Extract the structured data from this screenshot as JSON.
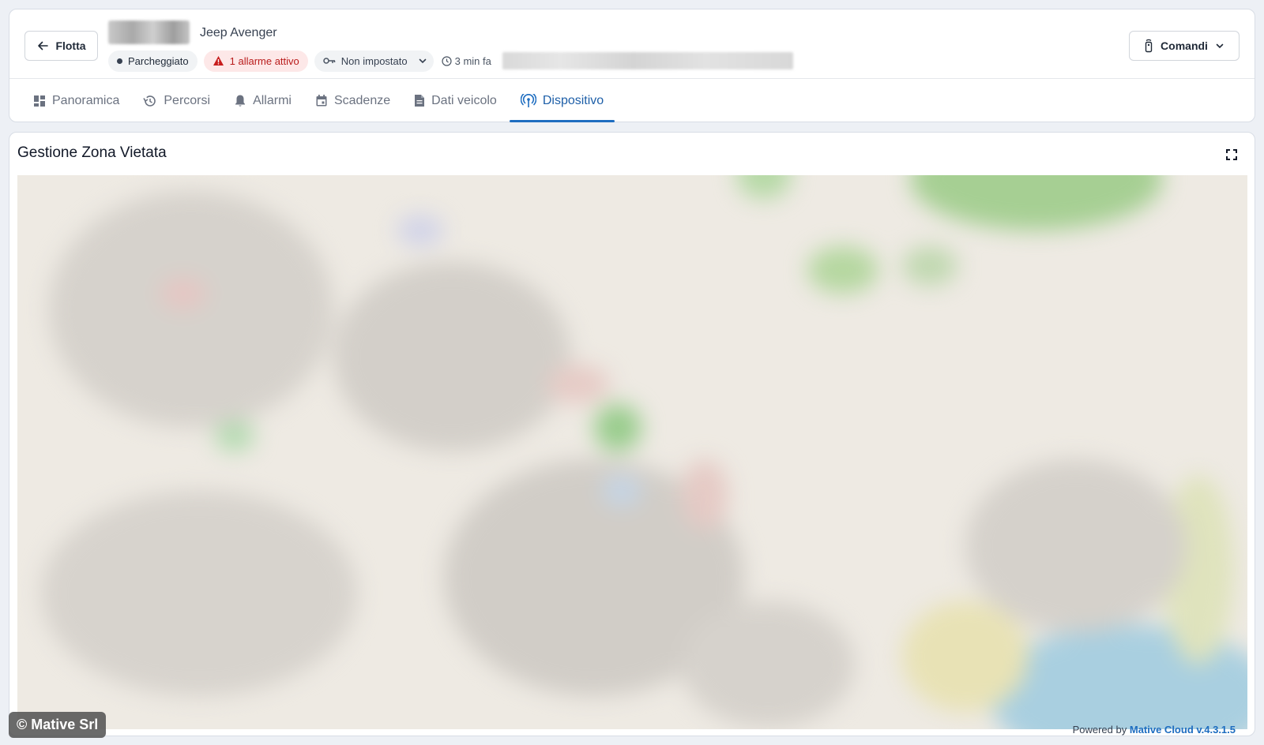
{
  "header": {
    "back_label": "Flotta",
    "vehicle_name": "Jeep Avenger",
    "status_label": "Parcheggiato",
    "alarm_label": "1 allarme attivo",
    "key_label": "Non impostato",
    "last_update": "3 min fa",
    "commands_label": "Comandi"
  },
  "tabs": [
    {
      "label": "Panoramica",
      "icon": "dashboard-icon"
    },
    {
      "label": "Percorsi",
      "icon": "history-icon"
    },
    {
      "label": "Allarmi",
      "icon": "bell-icon"
    },
    {
      "label": "Scadenze",
      "icon": "calendar-icon"
    },
    {
      "label": "Dati veicolo",
      "icon": "document-icon"
    },
    {
      "label": "Dispositivo",
      "icon": "antenna-icon",
      "active": true
    }
  ],
  "map_panel": {
    "title": "Gestione Zona Vietata",
    "fullscreen_icon": "fullscreen-icon"
  },
  "footer": {
    "powered_prefix": "Powered by",
    "powered_brand": "Mative Cloud v.4.3.1.5",
    "copyright": "© Mative Srl"
  },
  "colors": {
    "accent": "#1e6dc0",
    "alarm": "#b91c1c",
    "alarm_bg": "#fde8e8"
  }
}
